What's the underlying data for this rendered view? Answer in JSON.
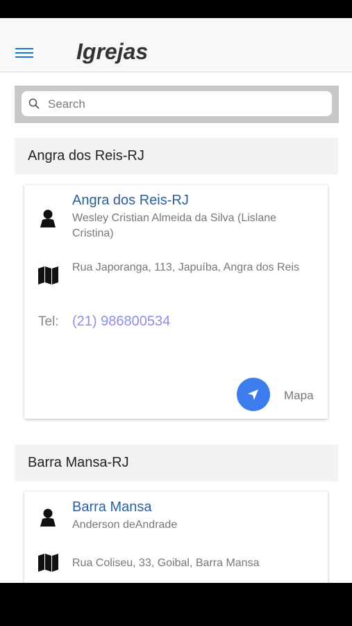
{
  "header": {
    "title": "Igrejas",
    "menu_icon": "hamburger-menu-icon"
  },
  "search": {
    "placeholder": "Search",
    "value": ""
  },
  "sections": [
    {
      "heading": "Angra dos Reis-RJ",
      "church": {
        "name": "Angra dos Reis-RJ",
        "pastor": "Wesley Cristian Almeida da Silva (Lislane Cristina)",
        "address": "Rua Japoranga, 113, Japuíba, Angra dos Reis",
        "tel_label": "Tel:",
        "tel": "(21) 986800534",
        "map_label": "Mapa"
      }
    },
    {
      "heading": "Barra Mansa-RJ",
      "church": {
        "name": "Barra Mansa",
        "pastor": "Anderson deAndrade",
        "address": "Rua Coliseu, 33, Goibal, Barra Mansa"
      }
    }
  ],
  "colors": {
    "accent": "#3b7ded",
    "link": "#2a5f9e",
    "phone": "#8b8ee8"
  }
}
